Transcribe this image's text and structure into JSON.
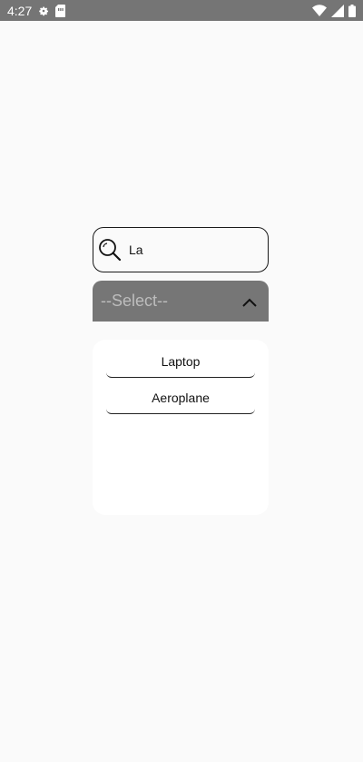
{
  "status_bar": {
    "time": "4:27",
    "icons": [
      "settings-icon",
      "sim-card-icon",
      "wifi-icon",
      "signal-icon",
      "battery-icon"
    ]
  },
  "search": {
    "value": "La",
    "icon": "search-icon"
  },
  "select": {
    "label": "--Select--",
    "icon": "chevron-up-icon"
  },
  "dropdown": {
    "options": [
      "Laptop",
      "Aeroplane"
    ]
  },
  "colors": {
    "status_bar": "#757575",
    "background": "#fafafa",
    "select_background": "#767676",
    "select_text": "#bdbdbd"
  }
}
